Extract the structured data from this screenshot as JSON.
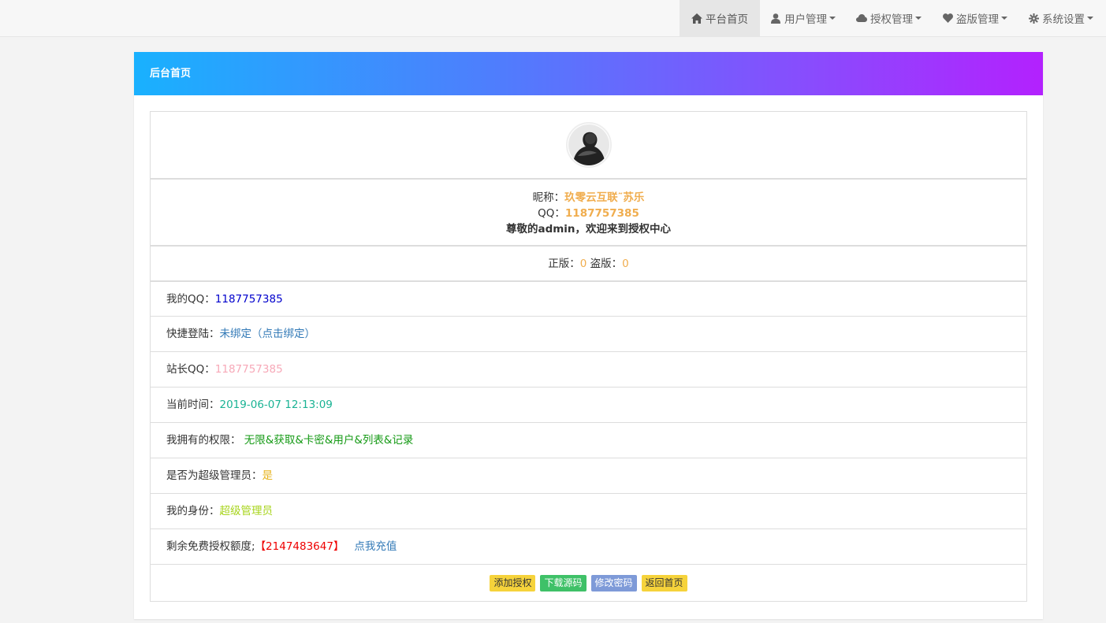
{
  "nav": {
    "items": [
      {
        "label": "平台首页",
        "icon": "home-icon"
      },
      {
        "label": "用户管理",
        "icon": "user-icon"
      },
      {
        "label": "授权管理",
        "icon": "cloud-icon"
      },
      {
        "label": "盗版管理",
        "icon": "heart-icon"
      },
      {
        "label": "系统设置",
        "icon": "gear-icon"
      }
    ]
  },
  "panel": {
    "title": "后台首页"
  },
  "profile": {
    "nickname_label": "昵称：",
    "nickname": "玖零云互联˜苏乐",
    "qq_label": "QQ：",
    "qq": "1187757385",
    "welcome": "尊敬的admin，欢迎来到授权中心"
  },
  "counts": {
    "genuine_label": "正版：",
    "genuine": "0",
    "pirate_label": " 盗版：",
    "pirate": "0"
  },
  "details": {
    "my_qq_label": "我的QQ：",
    "my_qq": "1187757385",
    "quick_login_label": "快捷登陆：",
    "quick_login": "未绑定（点击绑定）",
    "admin_qq_label": "站长QQ：",
    "admin_qq": "1187757385",
    "time_label": "当前时间：",
    "time": "2019-06-07 12:13:09",
    "perm_label": "我拥有的权限：",
    "perm": "无限&获取&卡密&用户&列表&记录",
    "super_label": "是否为超级管理员：",
    "super": "是",
    "identity_label": "我的身份：",
    "identity": "超级管理员",
    "quota_label": "剩余免费授权额度;",
    "quota": "【2147483647】",
    "recharge": "点我充值"
  },
  "buttons": {
    "add": "添加授权",
    "download": "下载源码",
    "password": "修改密码",
    "back": "返回首页"
  },
  "colors": {
    "gradient_start": "#19b1fe",
    "gradient_end": "#b321fe",
    "orange": "#f0ad4e"
  }
}
